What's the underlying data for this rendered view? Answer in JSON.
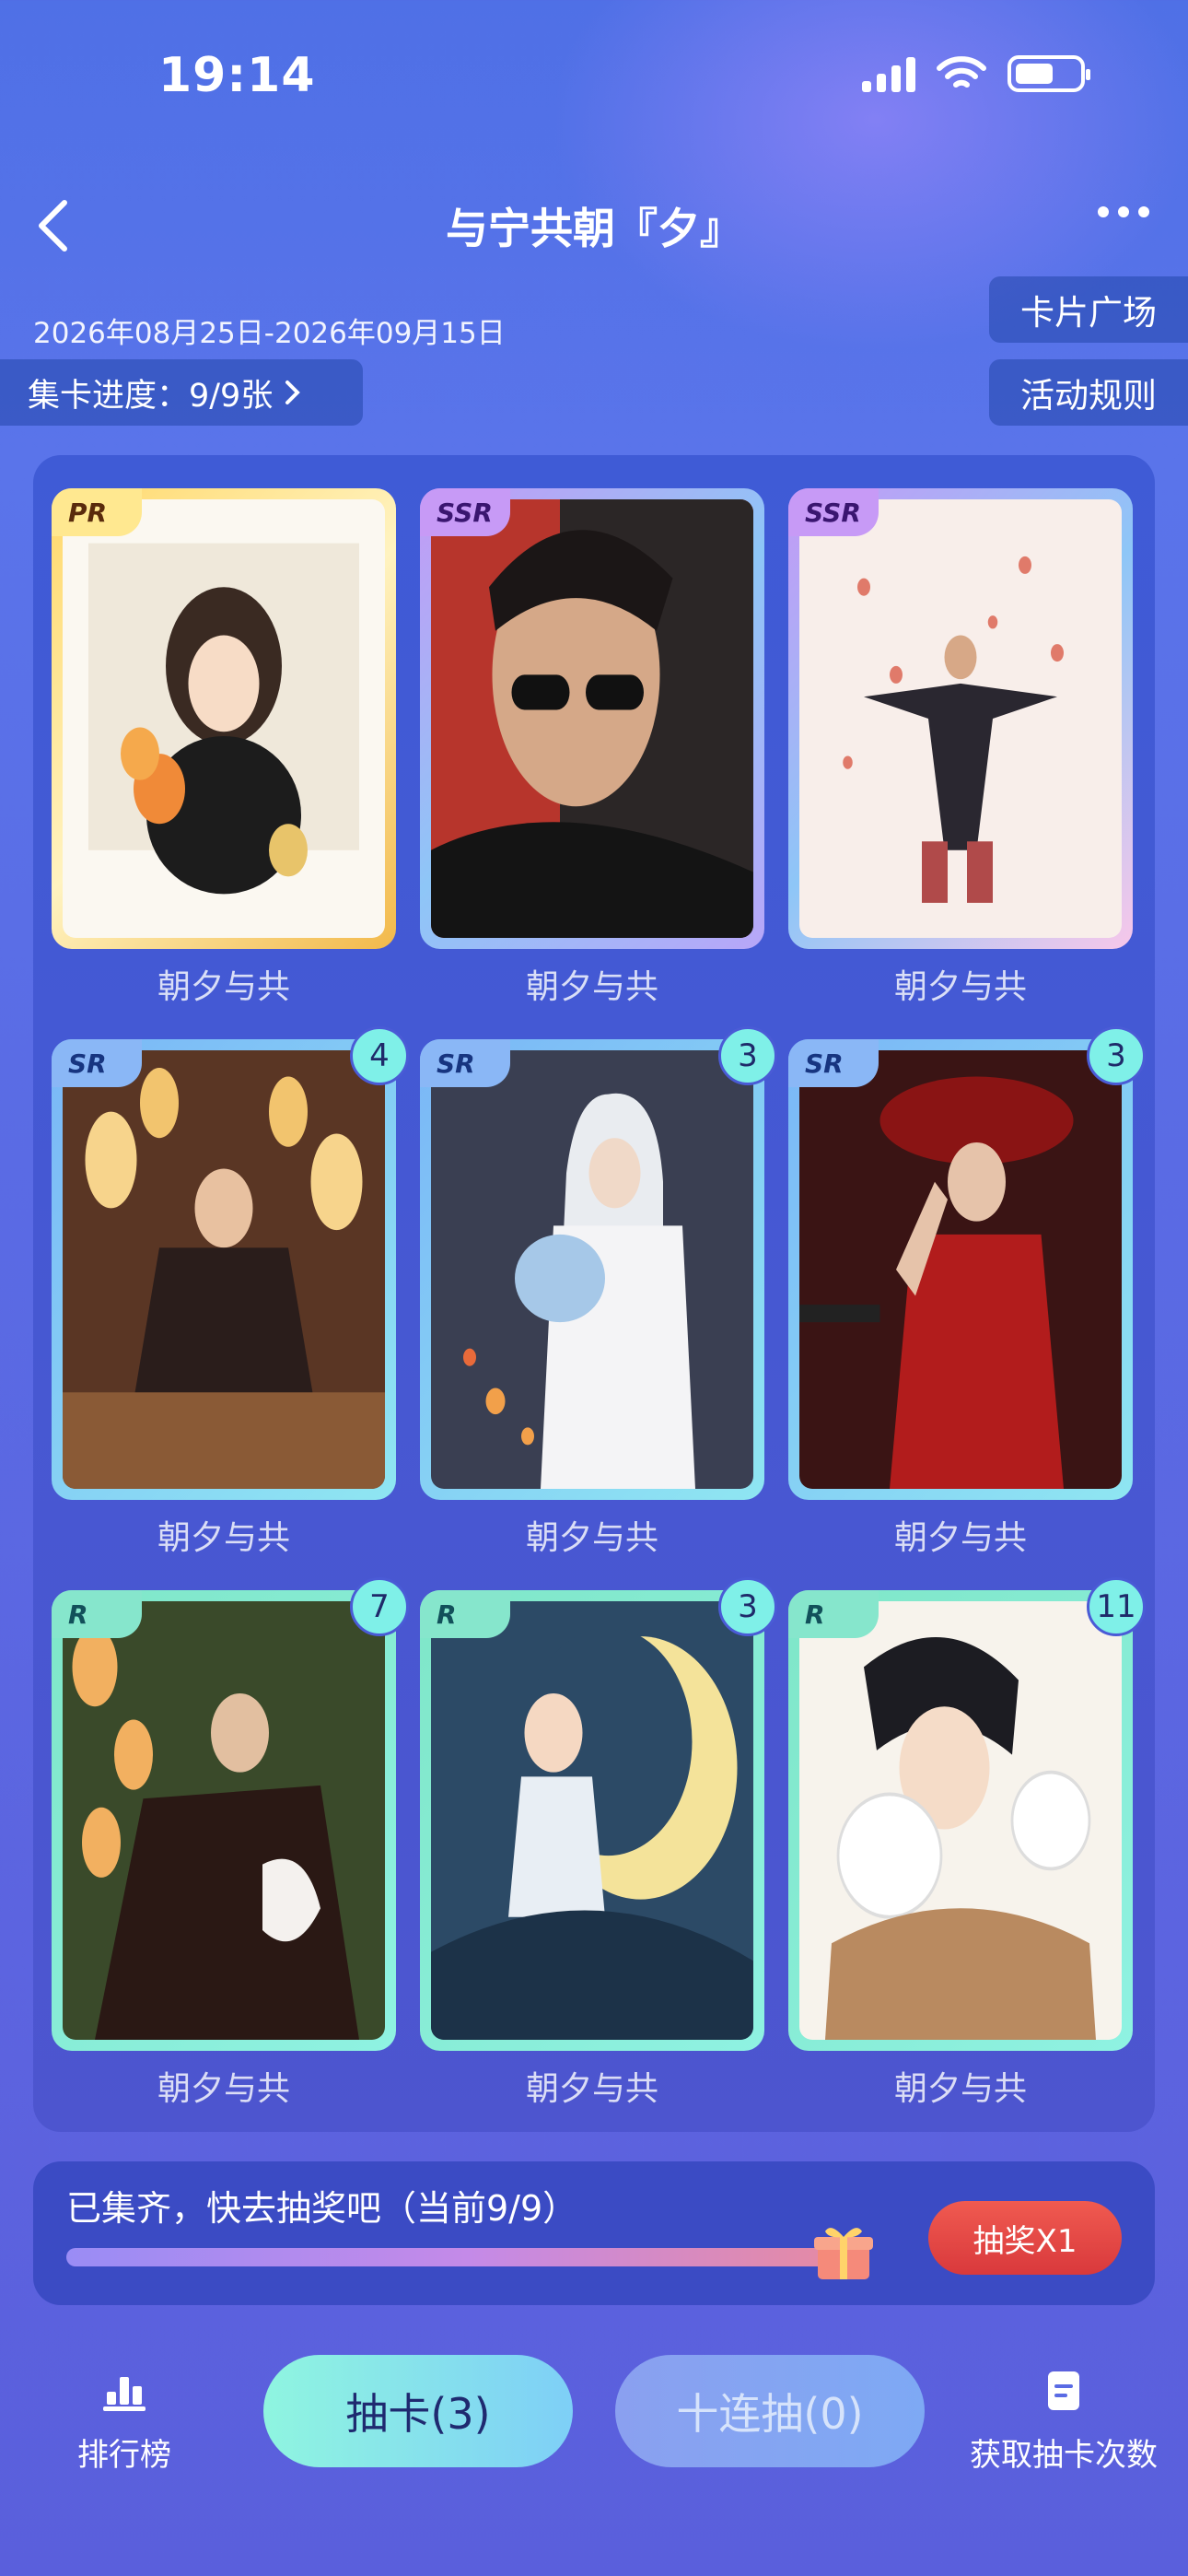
{
  "status_bar": {
    "time": "19:14"
  },
  "nav": {
    "title": "与宁共朝『夕』"
  },
  "date_range": "2026年08月25日-2026年09月15日",
  "collect_progress": "集卡进度：9/9张",
  "side_buttons": {
    "card_plaza": "卡片广场",
    "rules": "活动规则"
  },
  "cards": [
    {
      "rarity": "PR",
      "name": "朝夕与共",
      "count": ""
    },
    {
      "rarity": "SSR",
      "name": "朝夕与共",
      "count": ""
    },
    {
      "rarity": "SSR",
      "name": "朝夕与共",
      "count": ""
    },
    {
      "rarity": "SR",
      "name": "朝夕与共",
      "count": "4"
    },
    {
      "rarity": "SR",
      "name": "朝夕与共",
      "count": "3"
    },
    {
      "rarity": "SR",
      "name": "朝夕与共",
      "count": "3"
    },
    {
      "rarity": "R",
      "name": "朝夕与共",
      "count": "7"
    },
    {
      "rarity": "R",
      "name": "朝夕与共",
      "count": "3"
    },
    {
      "rarity": "R",
      "name": "朝夕与共",
      "count": "11"
    }
  ],
  "lottery": {
    "text": "已集齐，快去抽奖吧（当前9/9）",
    "progress": 1.0,
    "button": "抽奖X1"
  },
  "bottom": {
    "ranking": "排行榜",
    "draw": "抽卡(3)",
    "draw_ten": "十连抽(0)",
    "get_draws": "获取抽卡次数"
  }
}
